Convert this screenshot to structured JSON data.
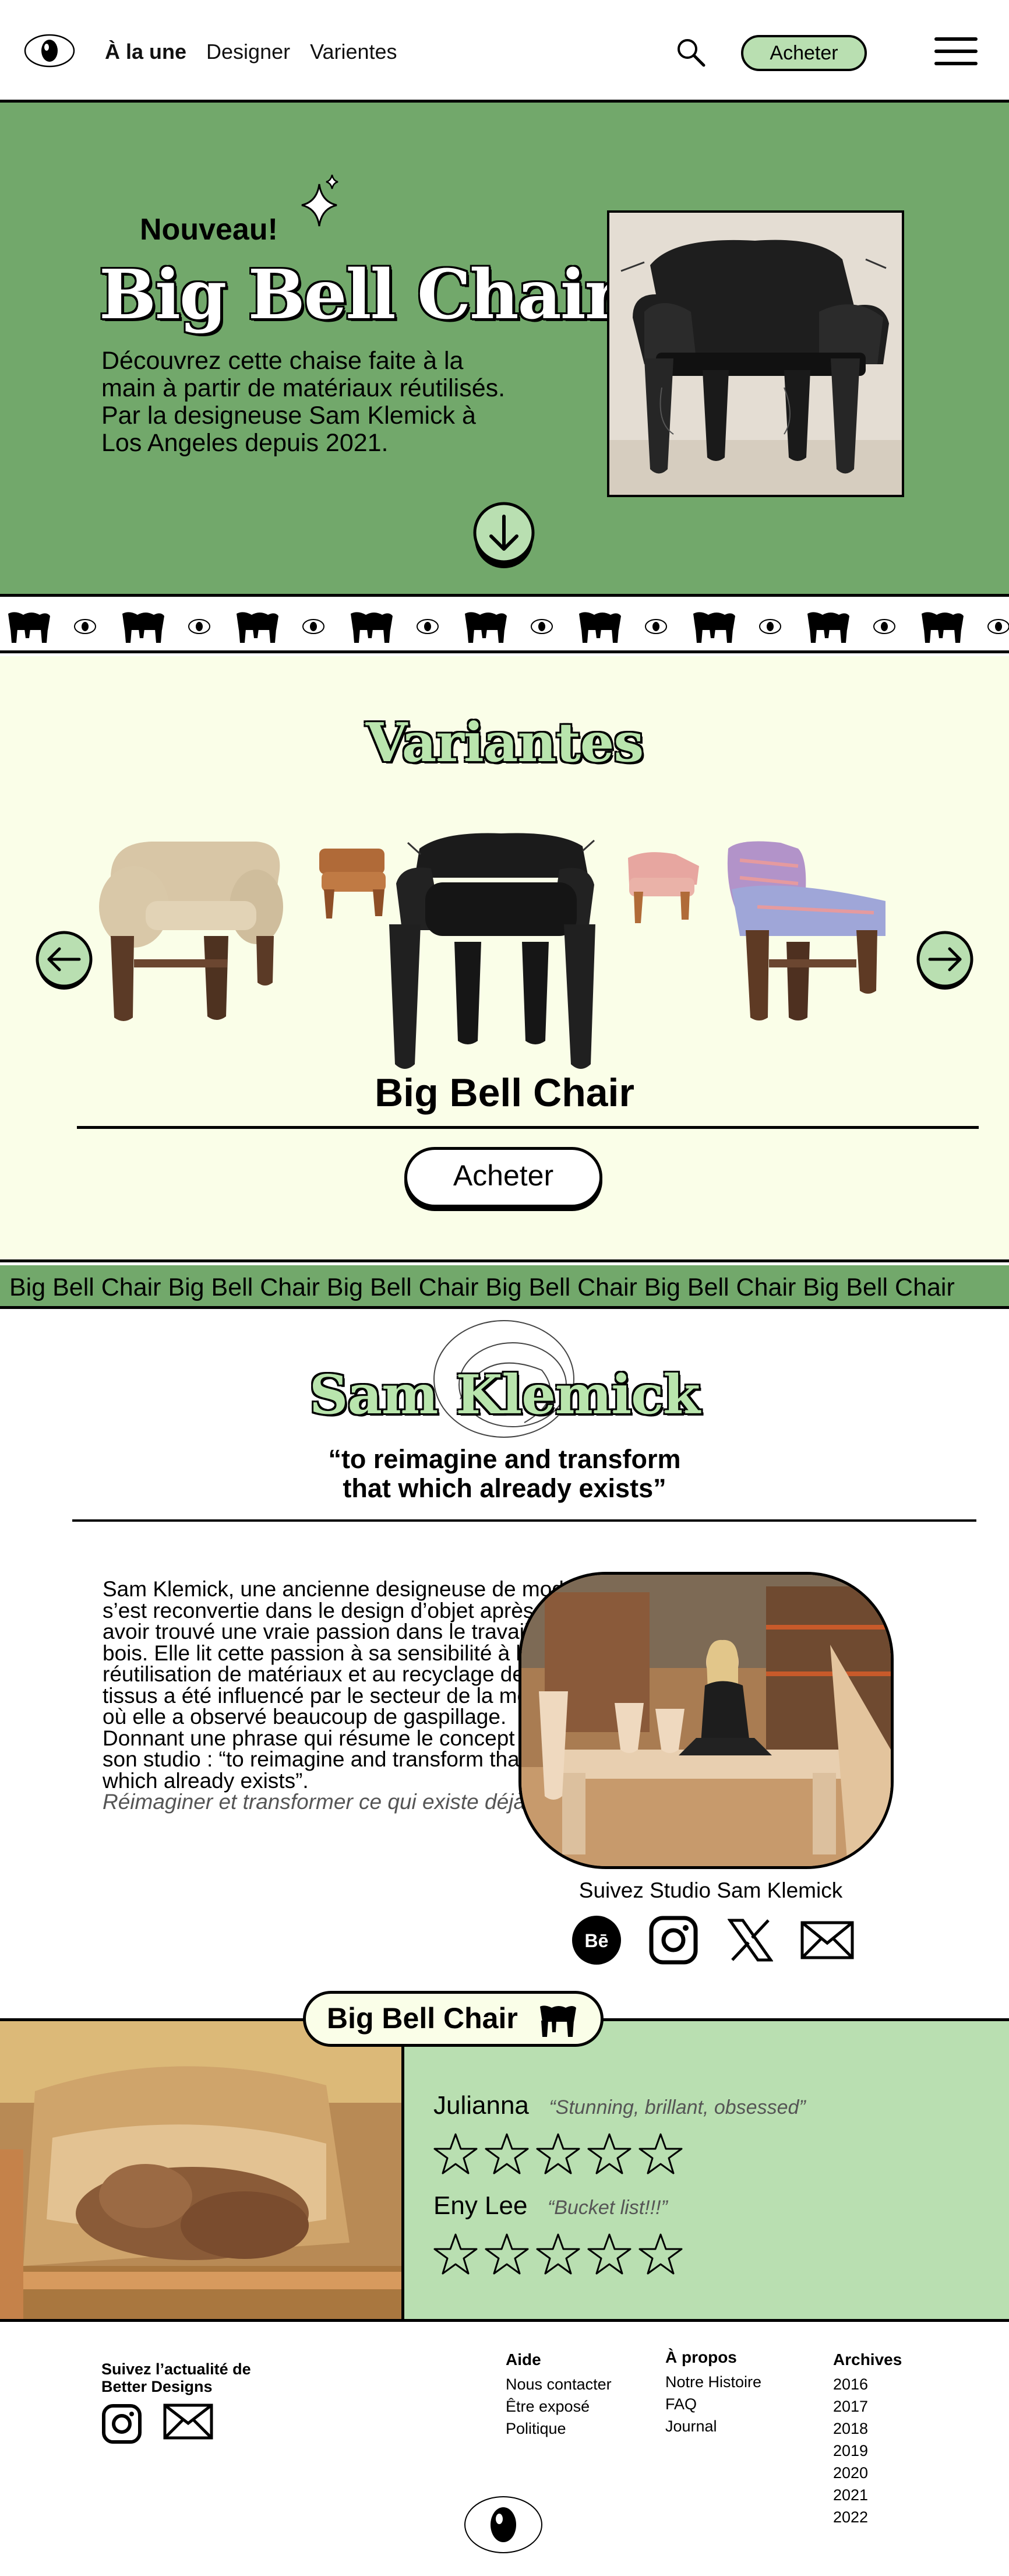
{
  "nav": {
    "links": [
      "À la une",
      "Designer",
      "Varientes"
    ],
    "buy_label": "Acheter",
    "icons": [
      "eye-logo-icon",
      "search-icon",
      "hamburger-menu-icon"
    ]
  },
  "hero": {
    "kicker": "Nouveau!",
    "title": "Big Bell Chair",
    "description": "Découvrez cette chaise faite à la main à partir de matériaux réutilisés. Par la designeuse Sam Klemick à Los Angeles depuis 2021.",
    "image": "black-leather-big-bell-chair-photo",
    "bg_color": "#72a86b"
  },
  "variantes": {
    "title": "Variantes",
    "product_name": "Big Bell Chair",
    "buy_label": "Acheter",
    "chairs": [
      "boucle-cream-chair",
      "small-tan-leather-chair",
      "black-leather-chair",
      "small-pink-chair",
      "patterned-fabric-chair"
    ]
  },
  "marquee": {
    "items": [
      "Big Bell Chair",
      "Big Bell Chair",
      "Big Bell Chair",
      "Big Bell Chair",
      "Big Bell Chair",
      "Big Bell Chair"
    ]
  },
  "designer": {
    "name": "Sam Klemick",
    "quote_line1": "“to reimagine and transform",
    "quote_line2": "that which already exists”",
    "bio": "Sam Klemick, une ancienne designeuse de mode s’est reconvertie dans le design d’objet après avoir trouvé une vraie passion dans le travail du bois. Elle lit cette passion à sa sensibilité à la réutilisation de matériaux et au recyclage de tissus a été influencé par le secteur de la mode où elle a observé beaucoup de gaspillage. Donnant une phrase qui résume le concept de son studio : “to reimagine and transform that which already exists”.",
    "bio_translation": "Réimaginer et transformer ce qui existe déjà",
    "follow": "Suivez Studio Sam Klemick",
    "socials": [
      "behance-icon",
      "instagram-icon",
      "x-icon",
      "mail-icon"
    ]
  },
  "reviews": {
    "badge": "Big Bell Chair",
    "items": [
      {
        "author": "Julianna",
        "text": "“Stunning, brillant, obsessed”",
        "stars": 5
      },
      {
        "author": "Eny Lee",
        "text": "“Bucket list!!!”",
        "stars": 5
      }
    ],
    "panel_color": "#b9dfb1"
  },
  "footer": {
    "follow_title": "Suivez l’actualité de Better Designs",
    "columns": [
      {
        "heading": "Aide",
        "items": [
          "Nous contacter",
          "Être exposé",
          "Politique"
        ]
      },
      {
        "heading": "À propos",
        "items": [
          "Notre Histoire",
          "FAQ",
          "Journal"
        ]
      },
      {
        "heading": "Archives",
        "items": [
          "2016",
          "2017",
          "2018",
          "2019",
          "2020",
          "2021",
          "2022"
        ]
      }
    ]
  }
}
